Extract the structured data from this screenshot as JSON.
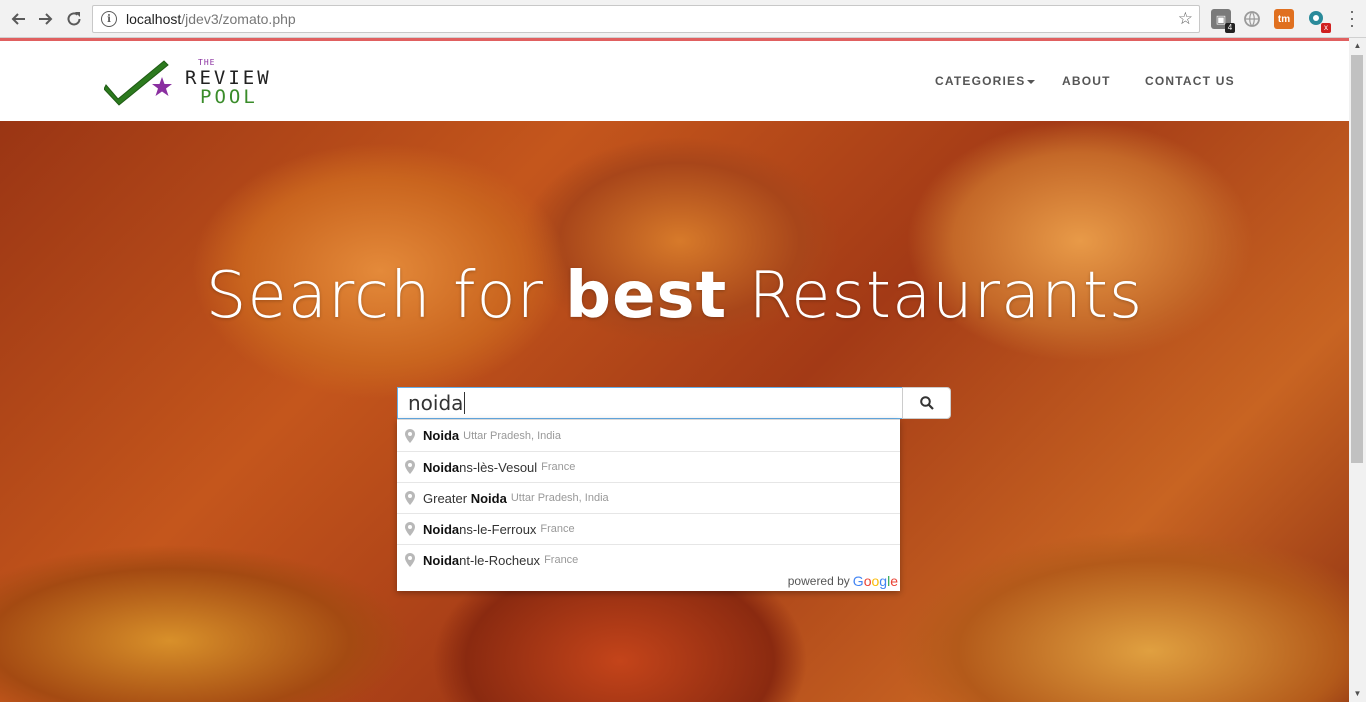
{
  "browser": {
    "url_host": "localhost",
    "url_path": "/jdev3/zomato.php",
    "extension_badges": [
      "4",
      "x"
    ]
  },
  "site": {
    "logo": {
      "the": "THE",
      "review": "REVIEW",
      "pool": "POOL"
    },
    "nav": {
      "categories": "CATEGORIES",
      "about": "ABOUT",
      "contact": "CONTACT US"
    },
    "hero": {
      "title_pre": "Search for",
      "title_bold": "best",
      "title_post": "Restaurants"
    },
    "search": {
      "value": "noida"
    },
    "suggestions": [
      {
        "pre": "",
        "match": "Noida",
        "post": "",
        "secondary": "Uttar Pradesh, India"
      },
      {
        "pre": "",
        "match": "Noida",
        "post": "ns-lès-Vesoul",
        "secondary": "France"
      },
      {
        "pre": "Greater ",
        "match": "Noida",
        "post": "",
        "secondary": "Uttar Pradesh, India"
      },
      {
        "pre": "",
        "match": "Noida",
        "post": "ns-le-Ferroux",
        "secondary": "France"
      },
      {
        "pre": "",
        "match": "Noida",
        "post": "nt-le-Rocheux",
        "secondary": "France"
      }
    ],
    "powered_by": "powered by",
    "google": "Google"
  }
}
